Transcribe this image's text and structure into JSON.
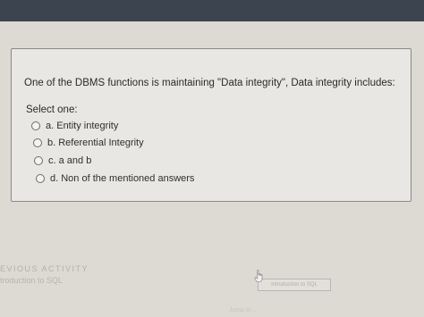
{
  "quiz": {
    "question": "One of the DBMS functions is maintaining \"Data integrity\", Data integrity includes:",
    "select_label": "Select one:",
    "options": [
      {
        "label": "a. Entity integrity"
      },
      {
        "label": "b. Referential Integrity"
      },
      {
        "label": "c. a and b"
      },
      {
        "label": "d. Non of the mentioned answers"
      }
    ]
  },
  "navigation": {
    "previous_heading": "EVIOUS ACTIVITY",
    "previous_link": "troduction to SQL",
    "next_activity_dropdown": "Introduction to SQL",
    "jump_label": "Jump to..."
  },
  "colors": {
    "card_background": "#e9e7e3",
    "card_border": "#8a8a8a",
    "page_background": "#ddd9d3"
  }
}
